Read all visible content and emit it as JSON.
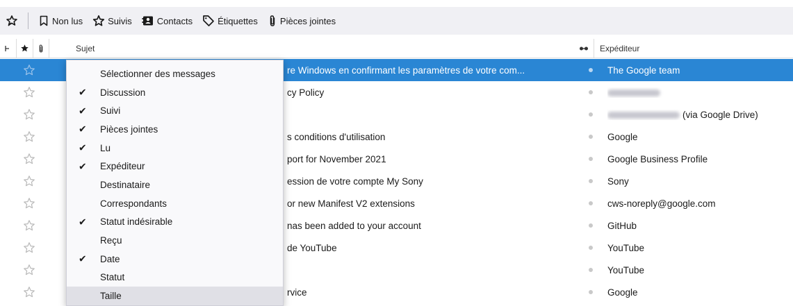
{
  "toolbar": {
    "buttons": [
      {
        "label": "Non lus",
        "icon": "bookmark-icon"
      },
      {
        "label": "Suivis",
        "icon": "star-outline-icon"
      },
      {
        "label": "Contacts",
        "icon": "address-book-icon"
      },
      {
        "label": "Étiquettes",
        "icon": "tag-icon"
      },
      {
        "label": "Pièces jointes",
        "icon": "paperclip-icon"
      }
    ]
  },
  "columns": {
    "subject": "Sujet",
    "sender": "Expéditeur"
  },
  "messages": [
    {
      "subject": "re Windows en confirmant les paramètres de votre com...",
      "sender": "The Google team",
      "selected": true
    },
    {
      "subject": "cy Policy",
      "sender": "",
      "sender_blurred": true
    },
    {
      "subject": "",
      "sender": "(via Google Drive)",
      "sender_blurred": true
    },
    {
      "subject": "s conditions d'utilisation",
      "sender": "Google"
    },
    {
      "subject": "port for November 2021",
      "sender": "Google Business Profile"
    },
    {
      "subject": "ession de votre compte My Sony",
      "sender": "Sony"
    },
    {
      "subject": "or new Manifest V2 extensions",
      "sender": "cws-noreply@google.com"
    },
    {
      "subject": "nas been added to your account",
      "sender": "GitHub"
    },
    {
      "subject": "de YouTube",
      "sender": "YouTube"
    },
    {
      "subject": "",
      "sender": "YouTube"
    },
    {
      "subject": "rvice",
      "sender": "Google"
    }
  ],
  "menu": {
    "items": [
      {
        "label": "Sélectionner des messages",
        "checked": false
      },
      {
        "label": "Discussion",
        "checked": true
      },
      {
        "label": "Suivi",
        "checked": true
      },
      {
        "label": "Pièces jointes",
        "checked": true
      },
      {
        "label": "Lu",
        "checked": true
      },
      {
        "label": "Expéditeur",
        "checked": true
      },
      {
        "label": "Destinataire",
        "checked": false
      },
      {
        "label": "Correspondants",
        "checked": false
      },
      {
        "label": "Statut indésirable",
        "checked": true
      },
      {
        "label": "Reçu",
        "checked": false
      },
      {
        "label": "Date",
        "checked": true
      },
      {
        "label": "Statut",
        "checked": false
      },
      {
        "label": "Taille",
        "checked": false,
        "highlighted": true
      }
    ]
  },
  "colors": {
    "selection": "#2a86d4",
    "toolbar_bg": "#f0f0f4",
    "menu_bg": "#f9f9fb",
    "menu_highlight": "#e0e0e6"
  }
}
